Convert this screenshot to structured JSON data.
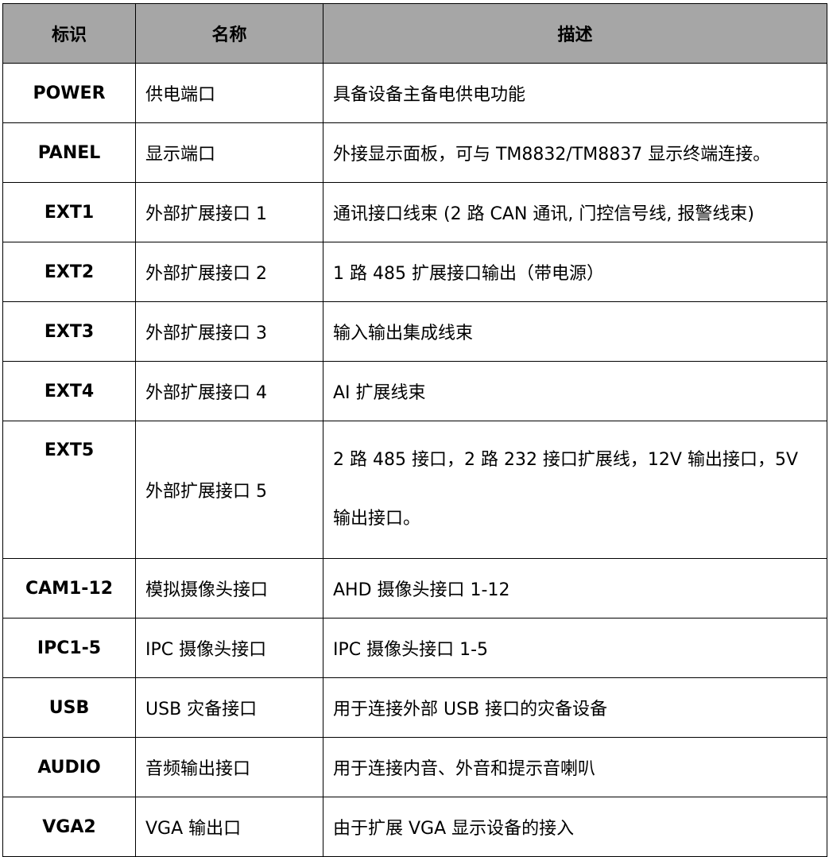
{
  "headers": [
    "标识",
    "名称",
    "描述"
  ],
  "rows": [
    {
      "id": "POWER",
      "name": "供电端口",
      "desc": "具备设备主备电供电功能"
    },
    {
      "id": "PANEL",
      "name": "显示端口",
      "desc": "外接显示面板，可与 TM8832/TM8837 显示终端连接。"
    },
    {
      "id": "EXT1",
      "name": "外部扩展接口 1",
      "desc": "通讯接口线束 (2 路 CAN 通讯, 门控信号线, 报警线束)"
    },
    {
      "id": "EXT2",
      "name": "外部扩展接口 2",
      "desc": "1 路 485 扩展接口输出（带电源）"
    },
    {
      "id": "EXT3",
      "name": "外部扩展接口 3",
      "desc": "输入输出集成线束"
    },
    {
      "id": "EXT4",
      "name": "外部扩展接口 4",
      "desc": "AI 扩展线束"
    },
    {
      "id": "EXT5",
      "name": "外部扩展接口 5",
      "desc": "2 路 485 接口，2 路 232 接口扩展线，12V 输出接口，5V 输出接口。"
    },
    {
      "id": "CAM1-12",
      "name": "模拟摄像头接口",
      "desc": "AHD 摄像头接口 1-12"
    },
    {
      "id": "IPC1-5",
      "name": "IPC 摄像头接口",
      "desc": "IPC 摄像头接口 1-5"
    },
    {
      "id": "USB",
      "name": "USB 灾备接口",
      "desc": "用于连接外部 USB 接口的灾备设备"
    },
    {
      "id": "AUDIO",
      "name": "音频输出接口",
      "desc": "用于连接内音、外音和提示音喇叭"
    },
    {
      "id": "VGA2",
      "name": "VGA 输出口",
      "desc": "由于扩展 VGA 显示设备的接入"
    }
  ]
}
